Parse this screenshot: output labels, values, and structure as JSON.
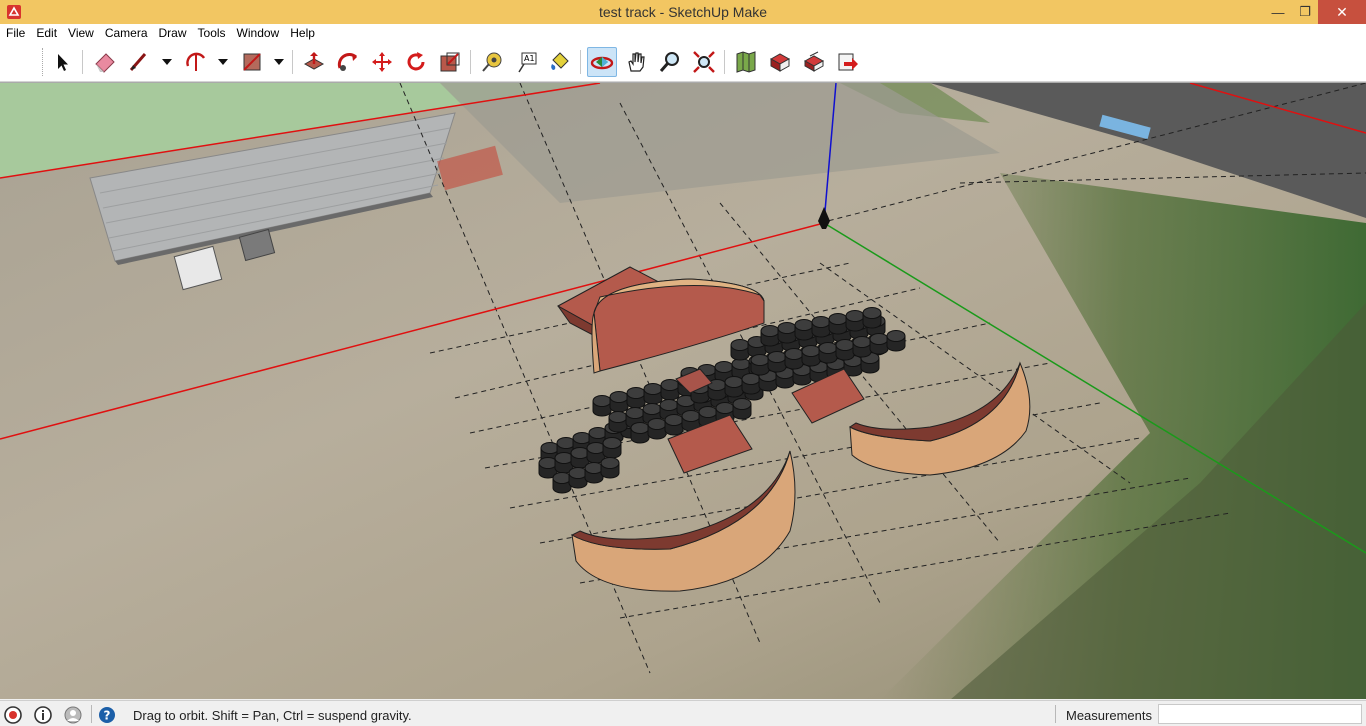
{
  "window": {
    "title": "test track - SketchUp Make",
    "minimize_glyph": "—",
    "maximize_glyph": "❐",
    "close_glyph": "✕"
  },
  "menu": {
    "items": [
      "File",
      "Edit",
      "View",
      "Camera",
      "Draw",
      "Tools",
      "Window",
      "Help"
    ]
  },
  "toolbar": {
    "tools": [
      {
        "name": "select-icon"
      },
      {
        "name": "eraser-icon"
      },
      {
        "name": "line-icon"
      },
      {
        "name": "arc-icon"
      },
      {
        "name": "rectangle-icon"
      },
      {
        "name": "push-pull-icon"
      },
      {
        "name": "follow-me-icon"
      },
      {
        "name": "move-icon"
      },
      {
        "name": "rotate-icon"
      },
      {
        "name": "scale-icon"
      },
      {
        "name": "tape-measure-icon"
      },
      {
        "name": "text-icon"
      },
      {
        "name": "paint-bucket-icon"
      },
      {
        "name": "orbit-icon",
        "active": true
      },
      {
        "name": "pan-icon"
      },
      {
        "name": "zoom-icon"
      },
      {
        "name": "zoom-extents-icon"
      },
      {
        "name": "add-location-icon"
      },
      {
        "name": "get-models-icon"
      },
      {
        "name": "share-model-icon"
      },
      {
        "name": "extension-warehouse-icon"
      }
    ],
    "text_tool_label": "A1"
  },
  "status": {
    "hint": "Drag to orbit. Shift = Pan, Ctrl = suspend gravity.",
    "measurements_label": "Measurements",
    "measurements_value": ""
  },
  "colors": {
    "titlebar": "#f2c662",
    "close": "#c7503e",
    "ground": "#b8ae9c",
    "ramp_face": "#b0594c",
    "ramp_side": "#d9a679",
    "tire": "#3a3a3a",
    "axis_red": "#e01010",
    "axis_green": "#1a9a1a",
    "axis_blue": "#1010d0"
  }
}
